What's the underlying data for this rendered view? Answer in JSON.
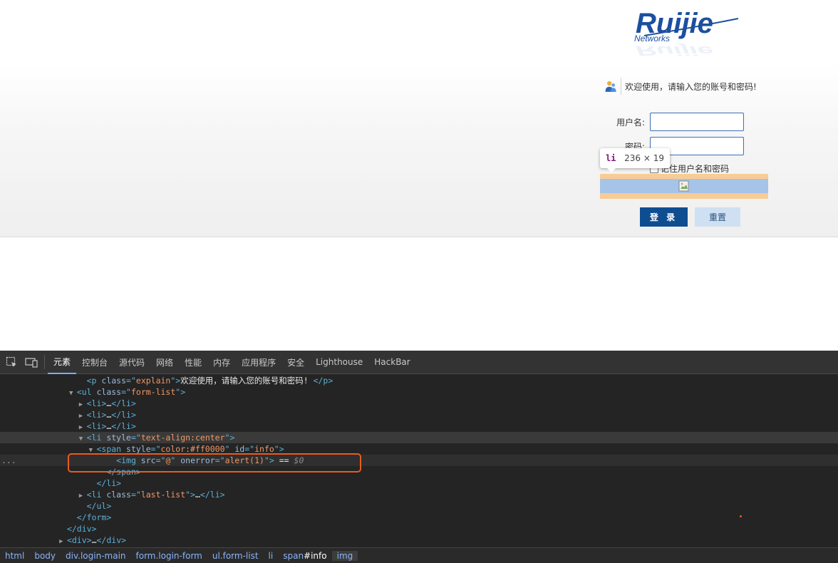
{
  "login": {
    "logo_text": "Ruijie",
    "logo_subtext": "Networks",
    "welcome": "欢迎使用，请输入您的账号和密码!",
    "username_label": "用户名:",
    "password_label": "密码:",
    "remember_label": "记住用户名和密码",
    "login_button": "登 录",
    "reset_button": "重置",
    "colors": {
      "brand": "#0f4d91",
      "login_button": "#0f4d91",
      "reset_button": "#cfe0f2"
    }
  },
  "tooltip": {
    "tag": "li",
    "size": "236 × 19"
  },
  "devtools": {
    "tabs": [
      "元素",
      "控制台",
      "源代码",
      "网络",
      "性能",
      "内存",
      "应用程序",
      "安全",
      "Lighthouse",
      "HackBar"
    ],
    "active_tab": "元素",
    "lines": [
      {
        "indent": "     ",
        "parts": [
          [
            "tag",
            "<p "
          ],
          [
            "attr",
            "class"
          ],
          [
            "tag",
            "=\""
          ],
          [
            "val",
            "explain"
          ],
          [
            "tag",
            "\">"
          ],
          [
            "text",
            "欢迎使用，请输入您的账号和密码! "
          ],
          [
            "tag",
            "</p>"
          ]
        ]
      },
      {
        "indent": "    ",
        "tri": "▼",
        "parts": [
          [
            "tag",
            "<ul "
          ],
          [
            "attr",
            "class"
          ],
          [
            "tag",
            "=\""
          ],
          [
            "val",
            "form-list"
          ],
          [
            "tag",
            "\">"
          ]
        ]
      },
      {
        "indent": "     ",
        "tri": "▶",
        "parts": [
          [
            "tag",
            "<li>"
          ],
          [
            "text",
            "…"
          ],
          [
            "tag",
            "</li>"
          ]
        ]
      },
      {
        "indent": "     ",
        "tri": "▶",
        "parts": [
          [
            "tag",
            "<li>"
          ],
          [
            "text",
            "…"
          ],
          [
            "tag",
            "</li>"
          ]
        ]
      },
      {
        "indent": "     ",
        "tri": "▶",
        "parts": [
          [
            "tag",
            "<li>"
          ],
          [
            "text",
            "…"
          ],
          [
            "tag",
            "</li>"
          ]
        ]
      },
      {
        "indent": "     ",
        "tri": "▼",
        "hover": true,
        "parts": [
          [
            "tag",
            "<li "
          ],
          [
            "attr",
            "style"
          ],
          [
            "tag",
            "=\""
          ],
          [
            "val",
            "text-align:center"
          ],
          [
            "tag",
            "\">"
          ]
        ]
      },
      {
        "indent": "      ",
        "tri": "▼",
        "parts": [
          [
            "tag",
            "<span "
          ],
          [
            "attr",
            "style"
          ],
          [
            "tag",
            "=\""
          ],
          [
            "val",
            "color:#ff0000"
          ],
          [
            "tag",
            "\" "
          ],
          [
            "attr",
            "id"
          ],
          [
            "tag",
            "=\""
          ],
          [
            "val",
            "info"
          ],
          [
            "tag",
            "\">"
          ]
        ]
      },
      {
        "indent": "        ",
        "selected": true,
        "gutter": "...",
        "parts": [
          [
            "tag",
            "<img "
          ],
          [
            "attr",
            "src"
          ],
          [
            "tag",
            "=\""
          ],
          [
            "val",
            "@"
          ],
          [
            "tag",
            "\" "
          ],
          [
            "attr",
            "onerror"
          ],
          [
            "tag",
            "=\""
          ],
          [
            "val",
            "alert(1)"
          ],
          [
            "tag",
            "\">"
          ],
          [
            "text",
            " == "
          ],
          [
            "muted",
            "$0"
          ]
        ]
      },
      {
        "indent": "       ",
        "parts": [
          [
            "tag",
            "</span>"
          ]
        ]
      },
      {
        "indent": "      ",
        "parts": [
          [
            "tag",
            "</li>"
          ]
        ]
      },
      {
        "indent": "     ",
        "tri": "▶",
        "parts": [
          [
            "tag",
            "<li "
          ],
          [
            "attr",
            "class"
          ],
          [
            "tag",
            "=\""
          ],
          [
            "val",
            "last-list"
          ],
          [
            "tag",
            "\">"
          ],
          [
            "text",
            "…"
          ],
          [
            "tag",
            "</li>"
          ]
        ]
      },
      {
        "indent": "     ",
        "parts": [
          [
            "tag",
            "</ul>"
          ]
        ]
      },
      {
        "indent": "    ",
        "parts": [
          [
            "tag",
            "</form>"
          ]
        ]
      },
      {
        "indent": "   ",
        "parts": [
          [
            "tag",
            "</div>"
          ]
        ]
      },
      {
        "indent": "   ",
        "tri": "▶",
        "parts": [
          [
            "tag",
            "<div>"
          ],
          [
            "text",
            "…"
          ],
          [
            "tag",
            "</div>"
          ]
        ]
      }
    ],
    "breadcrumb": [
      {
        "label": "html"
      },
      {
        "label": "body"
      },
      {
        "label": "div.login-main"
      },
      {
        "label": "form.login-form"
      },
      {
        "label": "ul.form-list"
      },
      {
        "label": "li"
      },
      {
        "label": "span",
        "hl": "#info"
      },
      {
        "label": "img",
        "current": true
      }
    ]
  }
}
